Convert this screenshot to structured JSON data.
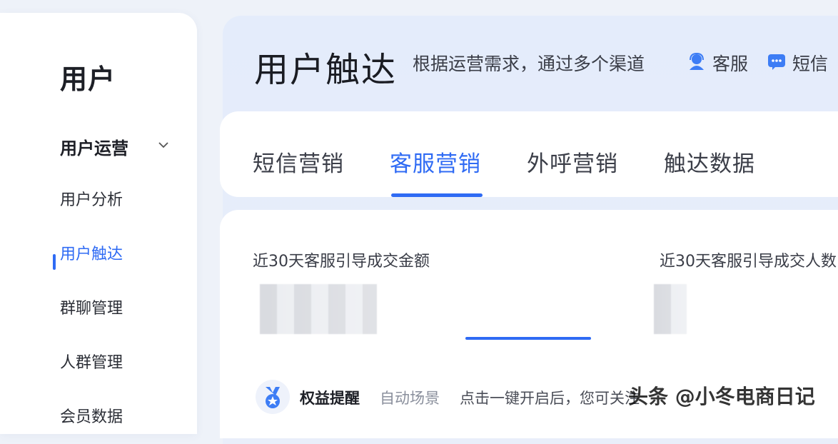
{
  "sidebar": {
    "title": "用户",
    "group_label": "用户运营",
    "items": [
      {
        "label": "用户分析"
      },
      {
        "label": "用户触达"
      },
      {
        "label": "群聊管理"
      },
      {
        "label": "人群管理"
      },
      {
        "label": "会员数据"
      }
    ],
    "active_index": 1
  },
  "header": {
    "title": "用户触达",
    "description": "根据运营需求，通过多个渠道",
    "channels": [
      {
        "label": "客服",
        "icon": "customer-service-icon"
      },
      {
        "label": "短信",
        "icon": "sms-icon"
      }
    ]
  },
  "tabs": [
    {
      "label": "短信营销"
    },
    {
      "label": "客服营销"
    },
    {
      "label": "外呼营销"
    },
    {
      "label": "触达数据"
    }
  ],
  "active_tab_index": 1,
  "metrics": [
    {
      "label": "近30天客服引导成交金额",
      "value_blurred": true
    },
    {
      "label": "近30天客服引导成交人数",
      "value_blurred": true
    }
  ],
  "bottom": {
    "badge": "权益提醒",
    "scene": "自动场景",
    "text": "点击一键开启后，您可关注"
  },
  "watermark": "头条 @小冬电商日记",
  "colors": {
    "accent": "#2f6bf4",
    "text": "#1d1f26",
    "muted": "#8a8f9c"
  }
}
